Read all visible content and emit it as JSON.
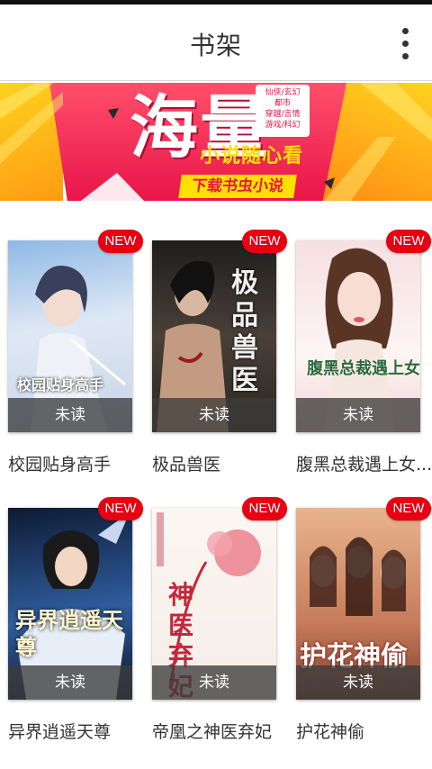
{
  "header": {
    "title": "书架",
    "menu_icon": "more-vertical-icon"
  },
  "banner": {
    "headline": "海量",
    "tags": [
      "仙侠/玄幻",
      "都市",
      "穿越/言情",
      "游戏/科幻"
    ],
    "slogan": "小说随心看",
    "cta": "下载书虫小说"
  },
  "books": [
    {
      "name": "校园贴身高手",
      "cover_title": "校园贴身高手",
      "badge": "NEW",
      "status": "未读",
      "colors": [
        "#9fc3e8",
        "#e9eef5"
      ]
    },
    {
      "name": "极品兽医",
      "cover_title": "极品兽医",
      "badge": "NEW",
      "status": "未读",
      "colors": [
        "#2b2b2b",
        "#8a7a6a"
      ]
    },
    {
      "name": "腹黑总裁遇上女...",
      "cover_title": "腹黑总裁遇上女",
      "badge": "NEW",
      "status": "未读",
      "colors": [
        "#f4d7d9",
        "#fbf1f1"
      ]
    },
    {
      "name": "异界逍遥天尊",
      "cover_title": "异界逍遥天尊",
      "badge": "NEW",
      "status": "未读",
      "colors": [
        "#1c2a44",
        "#3a66a8"
      ]
    },
    {
      "name": "帝凰之神医弃妃",
      "cover_title": "神医弃妃",
      "badge": "NEW",
      "status": "未读",
      "colors": [
        "#fbf6f2",
        "#d94c5c"
      ]
    },
    {
      "name": "护花神偷",
      "cover_title": "护花神偷",
      "badge": "NEW",
      "status": "未读",
      "colors": [
        "#c98a6a",
        "#e9c09a"
      ]
    }
  ]
}
